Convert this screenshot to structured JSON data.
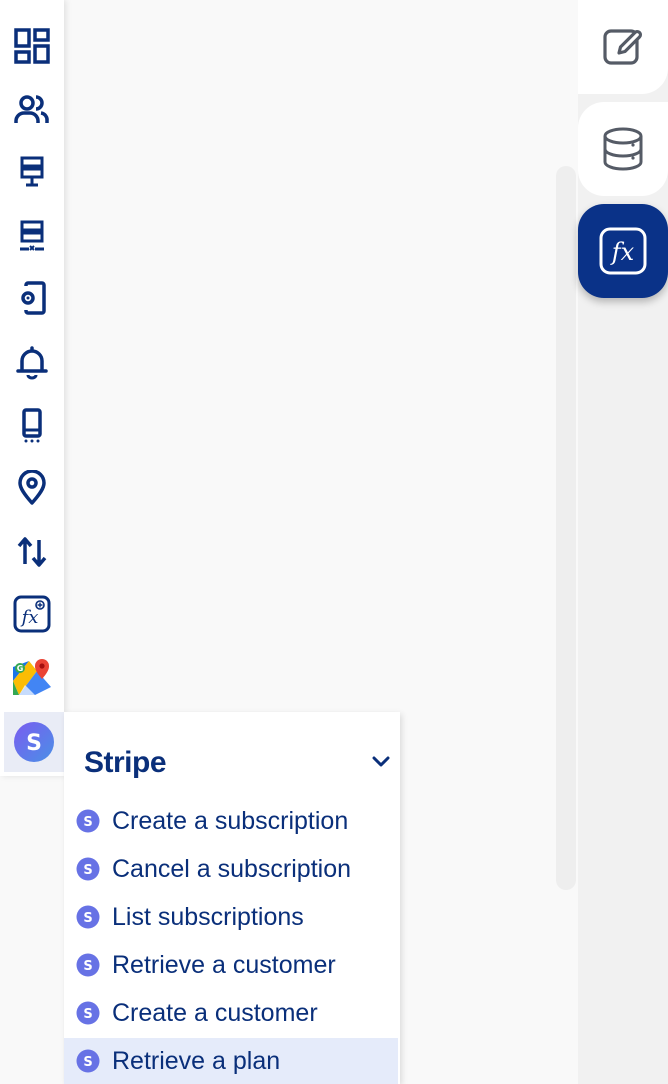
{
  "left_rail": {
    "items": [
      {
        "icon": "dashboard-icon"
      },
      {
        "icon": "users-icon"
      },
      {
        "icon": "server-icon"
      },
      {
        "icon": "server-remove-icon"
      },
      {
        "icon": "device-settings-icon"
      },
      {
        "icon": "bell-icon"
      },
      {
        "icon": "mobile-device-icon"
      },
      {
        "icon": "location-pin-icon"
      },
      {
        "icon": "sort-arrows-icon"
      },
      {
        "icon": "function-add-icon"
      },
      {
        "icon": "google-maps-icon"
      },
      {
        "icon": "stripe-icon",
        "active": true
      }
    ]
  },
  "flyout": {
    "title": "Stripe",
    "items": [
      {
        "label": "Create a subscription"
      },
      {
        "label": "Cancel a subscription"
      },
      {
        "label": "List subscriptions"
      },
      {
        "label": "Retrieve a customer"
      },
      {
        "label": "Create a customer"
      },
      {
        "label": "Retrieve a plan",
        "selected": true
      }
    ]
  },
  "right_tabs": [
    {
      "icon": "edit-icon"
    },
    {
      "icon": "database-icon"
    },
    {
      "icon": "function-icon",
      "active": true
    }
  ],
  "colors": {
    "primary": "#0a2f7a",
    "active_tab": "#0a3288",
    "selected_row": "#e5ebfa",
    "stripe_purple": "#6772e5"
  }
}
